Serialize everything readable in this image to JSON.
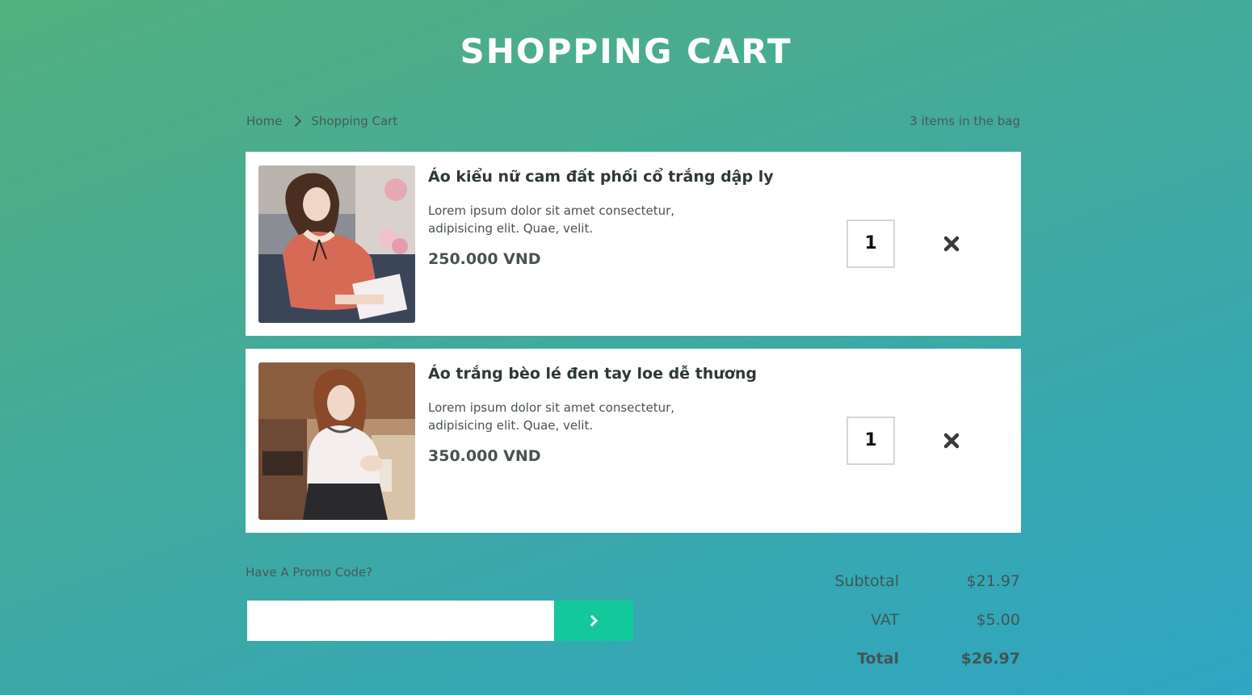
{
  "page": {
    "title": "SHOPPING CART"
  },
  "breadcrumb": {
    "home": "Home",
    "current": "Shopping Cart",
    "bag_count": "3 items in the bag"
  },
  "items": [
    {
      "name": "Áo kiểu nữ cam đất phối cổ trắng dập ly",
      "description": "Lorem ipsum dolor sit amet consectetur, adipisicing elit. Quae, velit.",
      "price": "250.000 VND",
      "quantity": "1",
      "image_icon": "product-photo-orange-blouse"
    },
    {
      "name": "Áo trắng bèo lé đen tay loe dễ thương",
      "description": "Lorem ipsum dolor sit amet consectetur, adipisicing elit. Quae, velit.",
      "price": "350.000 VND",
      "quantity": "1",
      "image_icon": "product-photo-white-blouse"
    }
  ],
  "promo": {
    "label": "Have A Promo Code?",
    "input_value": "",
    "submit_icon": "chevron-right-icon"
  },
  "summary": {
    "subtotal_label": "Subtotal",
    "subtotal_value": "$21.97",
    "vat_label": "VAT",
    "vat_value": "$5.00",
    "total_label": "Total",
    "total_value": "$26.97"
  },
  "colors": {
    "gradient_start": "#52b07e",
    "gradient_end": "#2ea6c4",
    "accent_button": "#13c89b",
    "card_background": "#ffffff",
    "text_dark": "#2e3838"
  }
}
